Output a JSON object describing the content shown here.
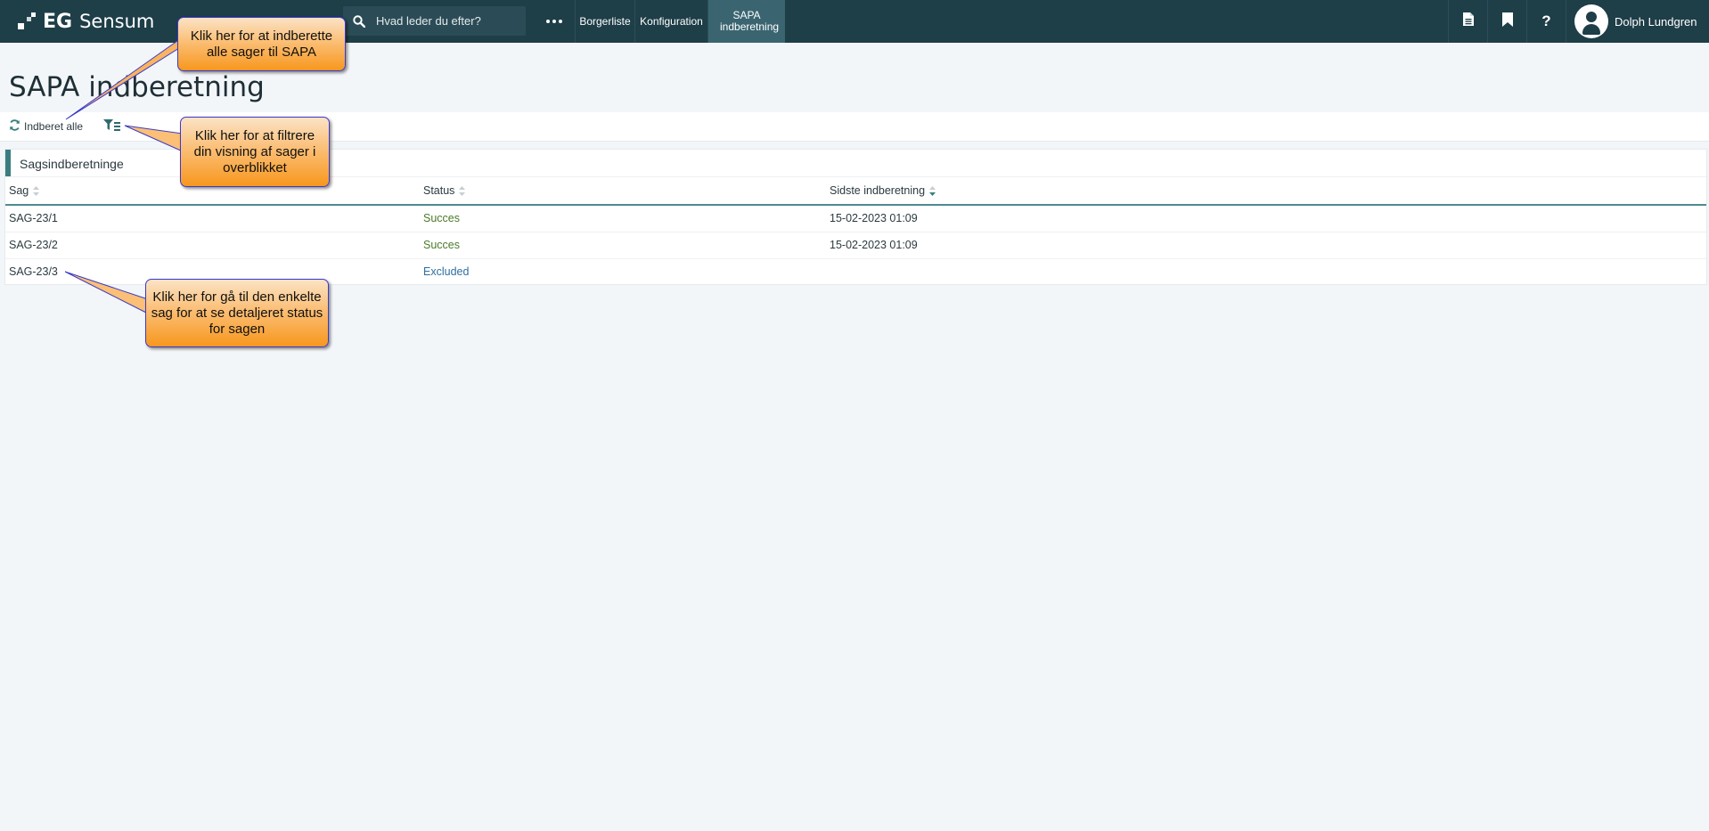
{
  "app": {
    "logo_eg": "EG",
    "logo_sensum": "Sensum",
    "search_placeholder": "Hvad leder du efter?",
    "nav": [
      {
        "label": "Borgerliste",
        "active": false
      },
      {
        "label": "Konfiguration",
        "active": false
      },
      {
        "label": "SAPA indberetning",
        "active": true
      }
    ],
    "help_label": "?",
    "user_name": "Dolph Lundgren",
    "brand_color": "#1e3e48"
  },
  "page": {
    "title": "SAPA indberetning",
    "toolbar": {
      "report_all_label": "Indberet alle"
    }
  },
  "table": {
    "title": "Sagsindberetninge",
    "columns": [
      "Sag",
      "Status",
      "Sidste indberetning"
    ],
    "rows": [
      {
        "sag": "SAG-23/1",
        "status": "Succes",
        "last": "15-02-2023 01:09"
      },
      {
        "sag": "SAG-23/2",
        "status": "Succes",
        "last": "15-02-2023 01:09"
      },
      {
        "sag": "SAG-23/3",
        "status": "Excluded",
        "last": ""
      }
    ]
  },
  "callouts": [
    "Klik her for at indberette alle sager til SAPA",
    "Klik her for at filtrere din visning af sager i overblikket",
    "Klik her for gå til den enkelte sag for at se detaljeret status for sagen"
  ]
}
